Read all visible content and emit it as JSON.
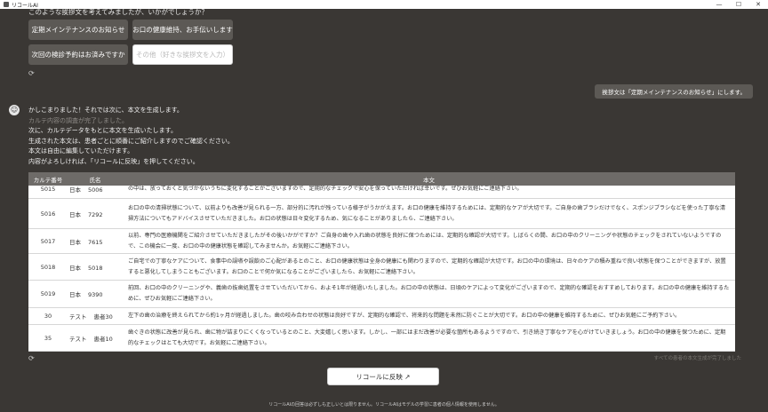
{
  "window": {
    "title": "リコールAI",
    "minimize": "—",
    "maximize": "☐",
    "close": "✕"
  },
  "question": "このような挨拶文を考えてみましたが、いかがでしょうか？",
  "options": {
    "opt1": "定期メインテナンスのお知らせ",
    "opt2": "お口の健康維持、お手伝いします",
    "opt3": "次回の検診予約はお済みですか",
    "custom_placeholder": "その他（好きな挨拶文を入力）"
  },
  "user_message": "挨拶文は「定期メインテナンスのお知らせ」にします。",
  "assistant": {
    "lines": [
      "かしこまりました！それでは次に、本文を生成します。",
      "カルテ内容の調査が完了しました。",
      "次に、カルテデータをもとに本文を生成いたします。",
      "生成された本文は、患者ごとに順番にご紹介しますのでご確認ください。",
      "本文は自由に編集していただけます。",
      "内容がよろしければ、「リコールに反映」を押してください。"
    ]
  },
  "table": {
    "headers": {
      "id": "カルテ番号",
      "name": "氏名",
      "body": "本文"
    },
    "rows": [
      {
        "id": "5015",
        "last": "日本",
        "first": "5006",
        "text": "の中は、放っておくと気づかないうちに変化することがございますので、定期的なチェックで安心を保っていただければ幸いです。ぜひお気軽にご連絡下さい。"
      },
      {
        "id": "5016",
        "last": "日本",
        "first": "7292",
        "text": "お口の中の清掃状態について、以前よりも改善が見られる一方、部分的に汚れが残っている様子がうかがえます。お口の健康を維持するためには、定期的なケアが大切です。ご自身の歯ブラシだけでなく、スポンジブラシなどを使った丁寧な清掃方法についてもアドバイスさせていただきました。お口の状態は日々変化するため、気になることがありましたら、ご連絡下さい。"
      },
      {
        "id": "5017",
        "last": "日本",
        "first": "7615",
        "text": "以前、専門の医療機関をご紹介させていただきましたがその後いかがですか？ご自身の歯や入れ歯の状態を良好に保つためには、定期的な確認が大切です。しばらくの間、お口の中のクリーニングや状態のチェックをされていないようですので、この機会に一度、お口の中の健康状態を確認してみませんか。お気軽にご連絡下さい。"
      },
      {
        "id": "5018",
        "last": "日本",
        "first": "5018",
        "text": "ご自宅での丁寧なケアについて、食事中の誤嚥や誤飲のご心配があるとのこと、お口の健康状態は全身の健康にも関わりますので、定期的な確認が大切です。お口の中の環境は、日々のケアの積み重ねで良い状態を保つことができますが、放置すると悪化してしまうこともございます。お口のことで何か気になることがございましたら、お気軽にご連絡下さい。"
      },
      {
        "id": "5019",
        "last": "日本",
        "first": "9390",
        "text": "前回、お口の中のクリーニングや、義歯の抜歯処置をさせていただいてから、およそ1年が経過いたしました。お口の中の状態は、日頃のケアによって変化がございますので、定期的な確認をおすすめしております。お口の中の健康を維持するために、ぜひお気軽にご連絡下さい。"
      },
      {
        "id": "30",
        "last": "テスト",
        "first": "患者30",
        "text": "左下の歯の治療を終えられてから約1ヶ月が経過しました。歯の咬み合わせの状態は良好ですが、定期的な確認で、将来的な問題を未然に防ぐことが大切です。お口の中の健康を維持するために、ぜひお気軽にご予約下さい。"
      },
      {
        "id": "35",
        "last": "テスト",
        "first": "患者10",
        "text": "歯ぐきの状態に改善が見られ、歯に物が詰まりにくくなっているとのこと、大変嬉しく思います。しかし、一部にはまだ改善が必要な箇所もあるようですので、引き続き丁寧なケアを心がけていきましょう。お口の中の健康を保つために、定期的なチェックはとても大切です。お気軽にご連絡下さい。"
      }
    ]
  },
  "done_note": "すべての患者の本文生成が完了しました",
  "reflect_button": "リコールに反映 ↗",
  "disclaimer": "リコールAIの回答は必ずしも正しいとは限りません。リコールAIはモデルの学習に患者の個人情報を使用しません。"
}
